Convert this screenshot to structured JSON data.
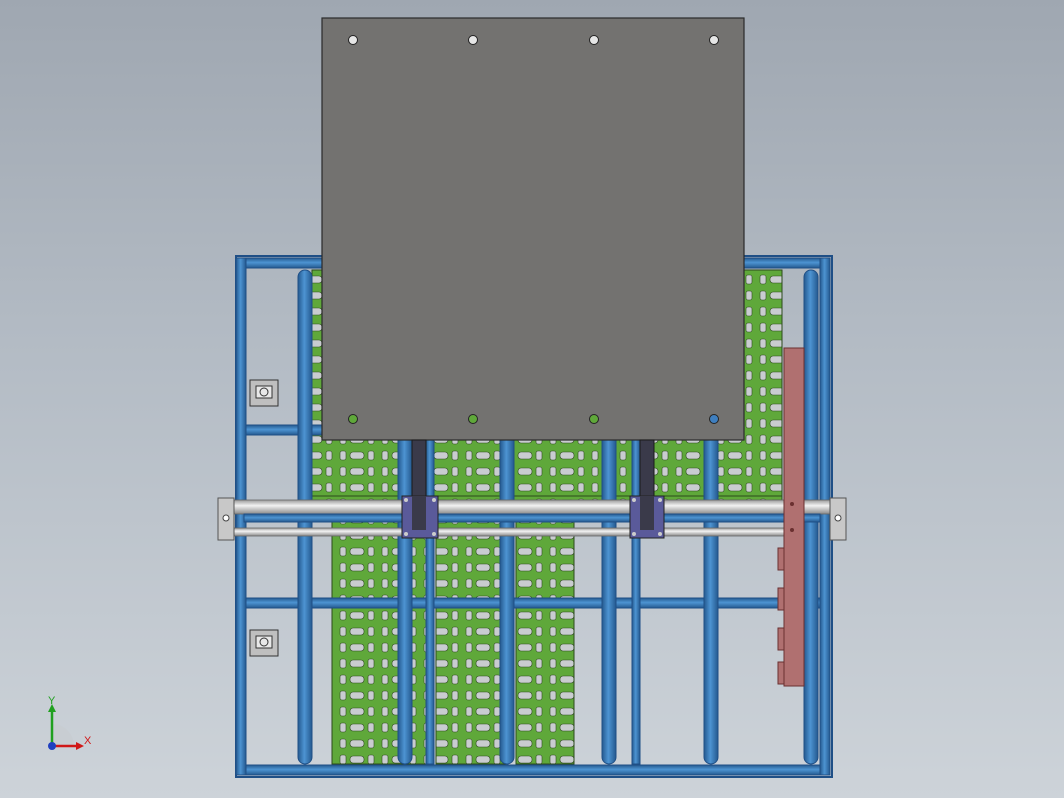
{
  "viewport": {
    "background_top": "#9fa7b1",
    "background_bottom": "#cdd3d9"
  },
  "model": {
    "frame_color": "#3f7fbf",
    "frame_dark": "#1f4f86",
    "tray_color": "#5fa83a",
    "tray_hole_color": "#c9ccd0",
    "plate_color": "#737270",
    "bracket_color": "#5a5a9a",
    "red_bar_color": "#b07070",
    "rod_color": "#d8d8d8"
  },
  "triad": {
    "x_label": "X",
    "y_label": "Y",
    "x_color": "#d01818",
    "y_color": "#20a020",
    "z_color": "#2040c0"
  }
}
